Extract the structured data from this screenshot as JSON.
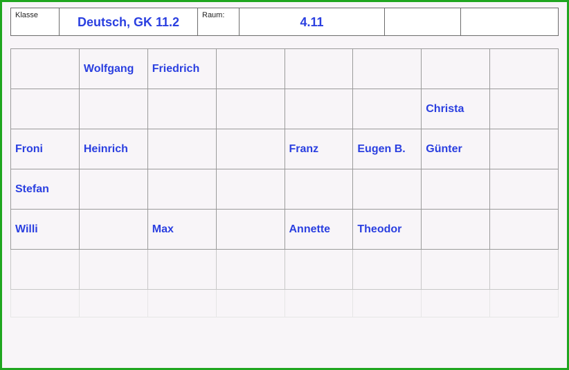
{
  "header": {
    "klasse_label": "Klasse",
    "course": "Deutsch, GK 11.2",
    "raum_label": "Raum:",
    "room": "4.11"
  },
  "seating": {
    "cols": 8,
    "rows": [
      {
        "fade": 0,
        "cells": [
          "",
          "Wolfgang",
          "Friedrich",
          "",
          "",
          "",
          "",
          ""
        ]
      },
      {
        "fade": 0,
        "cells": [
          "",
          "",
          "",
          "",
          "",
          "",
          "Christa",
          ""
        ]
      },
      {
        "fade": 0,
        "cells": [
          "Froni",
          "Heinrich",
          "",
          "",
          "Franz",
          "Eugen B.",
          "Günter",
          ""
        ]
      },
      {
        "fade": 0,
        "cells": [
          "Stefan",
          "",
          "",
          "",
          "",
          "",
          "",
          ""
        ]
      },
      {
        "fade": 0,
        "cells": [
          "Willi",
          "",
          "Max",
          "",
          "Annette",
          "Theodor",
          "",
          ""
        ]
      },
      {
        "fade": 1,
        "cells": [
          "",
          "",
          "",
          "",
          "",
          "",
          "",
          ""
        ]
      },
      {
        "fade": 2,
        "cells": [
          "",
          "",
          "",
          "",
          "",
          "",
          "",
          ""
        ]
      }
    ]
  }
}
